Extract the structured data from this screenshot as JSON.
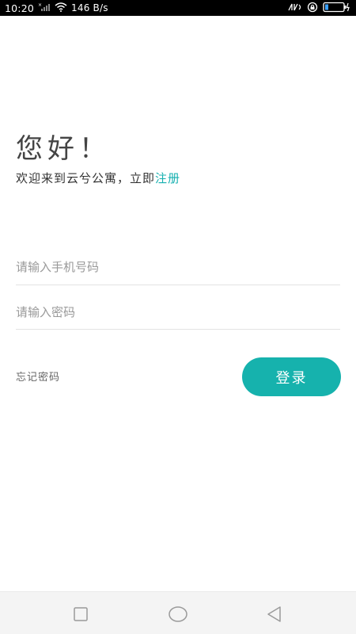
{
  "status_bar": {
    "time": "10:20",
    "network_speed": "146 B/s",
    "icons": [
      "signal-icon",
      "wifi-icon",
      "nfc-icon",
      "alarm-icon",
      "battery-icon"
    ]
  },
  "login": {
    "greeting": "您好！",
    "welcome_prefix": "欢迎来到云兮公寓，立即",
    "register_label": "注册",
    "phone_placeholder": "请输入手机号码",
    "phone_value": "",
    "password_placeholder": "请输入密码",
    "password_value": "",
    "forgot_password_label": "忘记密码",
    "login_button_label": "登录"
  },
  "colors": {
    "accent": "#16b2ad",
    "link": "#16b0b0",
    "background": "#ffffff",
    "status_bar": "#000000",
    "nav_bar": "#f4f4f4"
  },
  "nav_bar": {
    "icons": [
      "recent-apps-icon",
      "home-icon",
      "back-icon"
    ]
  }
}
